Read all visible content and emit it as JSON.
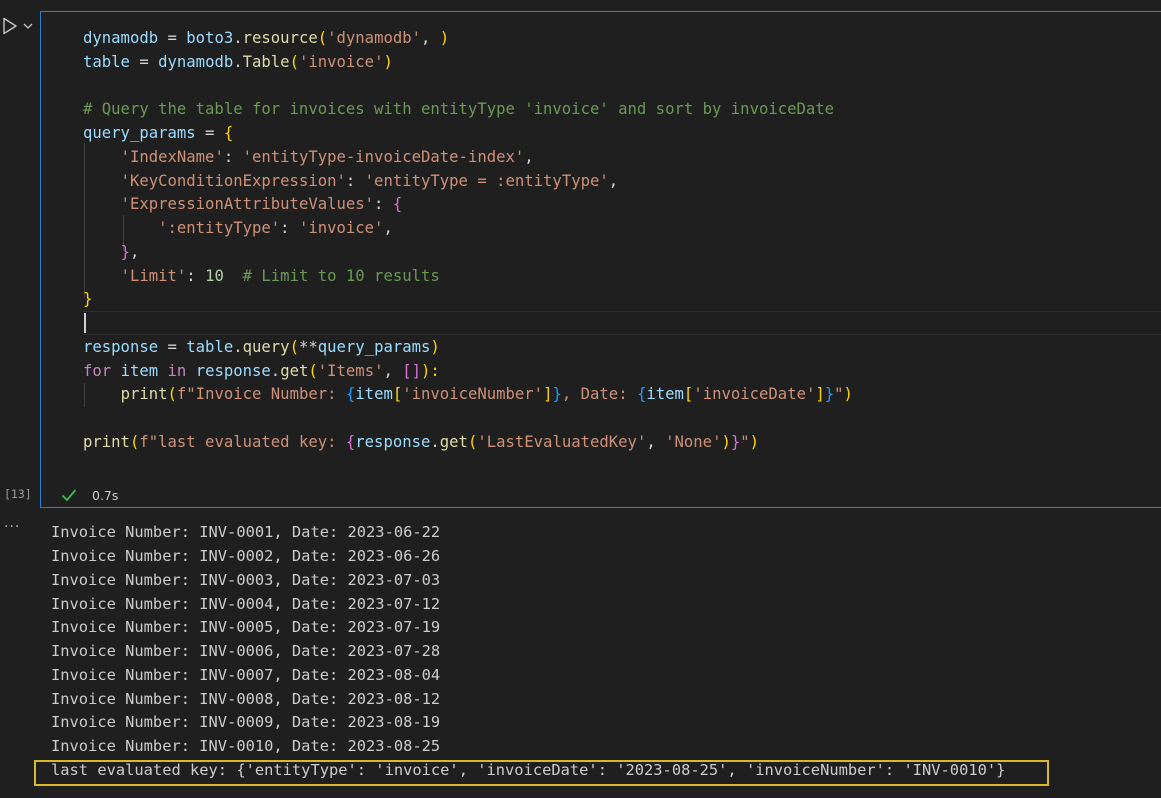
{
  "cell": {
    "execution_count": "[13]",
    "status_icon": "check-icon",
    "duration": "0.7s",
    "code": {
      "l1": {
        "t1": "dynamodb",
        "t2": " = ",
        "t3": "boto3",
        "t4": ".",
        "t5": "resource",
        "t6": "(",
        "t7": "'dynamodb'",
        "t8": ", ",
        "t9": ")"
      },
      "l2": {
        "t1": "table",
        "t2": " = ",
        "t3": "dynamodb",
        "t4": ".",
        "t5": "Table",
        "t6": "(",
        "t7": "'invoice'",
        "t8": ")"
      },
      "l4": {
        "t1": "# Query the table for invoices with entityType 'invoice' and sort by invoiceDate"
      },
      "l5": {
        "t1": "query_params",
        "t2": " = ",
        "t3": "{"
      },
      "l6": {
        "t1": "    ",
        "t2": "'IndexName'",
        "t3": ": ",
        "t4": "'entityType-invoiceDate-index'",
        "t5": ","
      },
      "l7": {
        "t1": "    ",
        "t2": "'KeyConditionExpression'",
        "t3": ": ",
        "t4": "'entityType = :entityType'",
        "t5": ","
      },
      "l8": {
        "t1": "    ",
        "t2": "'ExpressionAttributeValues'",
        "t3": ": ",
        "t4": "{"
      },
      "l9": {
        "t1": "        ",
        "t2": "':entityType'",
        "t3": ": ",
        "t4": "'invoice'",
        "t5": ","
      },
      "l10": {
        "t1": "    ",
        "t2": "}",
        "t3": ","
      },
      "l11": {
        "t1": "    ",
        "t2": "'Limit'",
        "t3": ": ",
        "t4": "10",
        "t5": "  ",
        "t6": "# Limit to 10 results"
      },
      "l12": {
        "t1": "}"
      },
      "l14": {
        "t1": "response",
        "t2": " = ",
        "t3": "table",
        "t4": ".",
        "t5": "query",
        "t6": "(",
        "t7": "**",
        "t8": "query_params",
        "t9": ")"
      },
      "l15": {
        "t1": "for",
        "t2": " ",
        "t3": "item",
        "t4": " ",
        "t5": "in",
        "t6": " ",
        "t7": "response",
        "t8": ".",
        "t9": "get",
        "t10": "(",
        "t11": "'Items'",
        "t12": ", ",
        "t13": "[]",
        "t14": "):"
      },
      "l16": {
        "t1": "    ",
        "t2": "print",
        "t3": "(",
        "t4": "f\"Invoice Number: ",
        "t5": "{",
        "t6": "item",
        "t7": "[",
        "t8": "'invoiceNumber'",
        "t9": "]",
        "t10": "}",
        "t11": ", Date: ",
        "t12": "{",
        "t13": "item",
        "t14": "[",
        "t15": "'invoiceDate'",
        "t16": "]",
        "t17": "}",
        "t18": "\"",
        "t19": ")"
      },
      "l18": {
        "t1": "print",
        "t2": "(",
        "t3": "f\"last evaluated key: ",
        "t4": "{",
        "t5": "response",
        "t6": ".",
        "t7": "get",
        "t8": "(",
        "t9": "'LastEvaluatedKey'",
        "t10": ", ",
        "t11": "'None'",
        "t12": ")",
        "t13": "}",
        "t14": "\"",
        "t15": ")"
      }
    }
  },
  "output": {
    "more_label": "···",
    "lines": [
      "Invoice Number: INV-0001, Date: 2023-06-22",
      "Invoice Number: INV-0002, Date: 2023-06-26",
      "Invoice Number: INV-0003, Date: 2023-07-03",
      "Invoice Number: INV-0004, Date: 2023-07-12",
      "Invoice Number: INV-0005, Date: 2023-07-19",
      "Invoice Number: INV-0006, Date: 2023-07-28",
      "Invoice Number: INV-0007, Date: 2023-08-04",
      "Invoice Number: INV-0008, Date: 2023-08-12",
      "Invoice Number: INV-0009, Date: 2023-08-19",
      "Invoice Number: INV-0010, Date: 2023-08-25"
    ],
    "last_key_line": "last evaluated key: {'entityType': 'invoice', 'invoiceDate': '2023-08-25', 'invoiceNumber': 'INV-0010'}"
  },
  "colors": {
    "background": "#1f1f1f",
    "cell_border": "#2f7fd1",
    "highlight_border": "#d9b928",
    "success_check": "#3fb950"
  }
}
